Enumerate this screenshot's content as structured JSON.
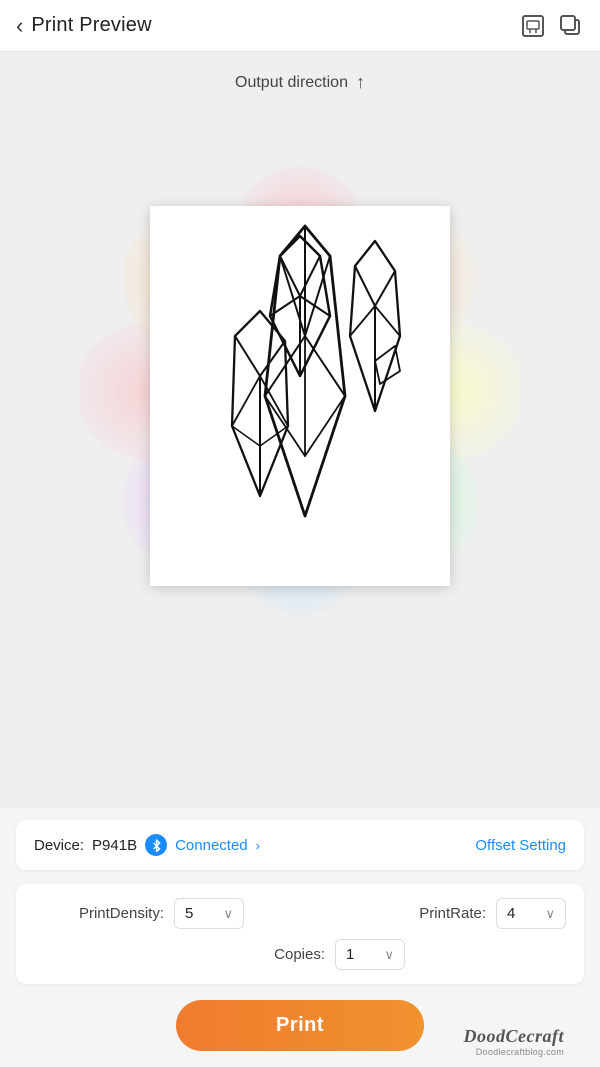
{
  "header": {
    "title": "Print Preview",
    "back_label": "‹",
    "icon_export": "⬒",
    "icon_copy": "⧉"
  },
  "preview": {
    "output_direction_label": "Output direction",
    "output_direction_arrow": "↑"
  },
  "device": {
    "label": "Device:",
    "name": "P941B",
    "status": "Connected",
    "chevron": "›",
    "offset_label": "Offset Setting"
  },
  "settings": {
    "density_label": "PrintDensity:",
    "density_value": "5",
    "rate_label": "PrintRate:",
    "rate_value": "4",
    "copies_label": "Copies:",
    "copies_value": "1",
    "dropdown_arrow": "∨"
  },
  "print": {
    "button_label": "Print"
  },
  "watermark": {
    "main": "DoodCecraft",
    "sub": "Doodlecraftblog.com"
  }
}
